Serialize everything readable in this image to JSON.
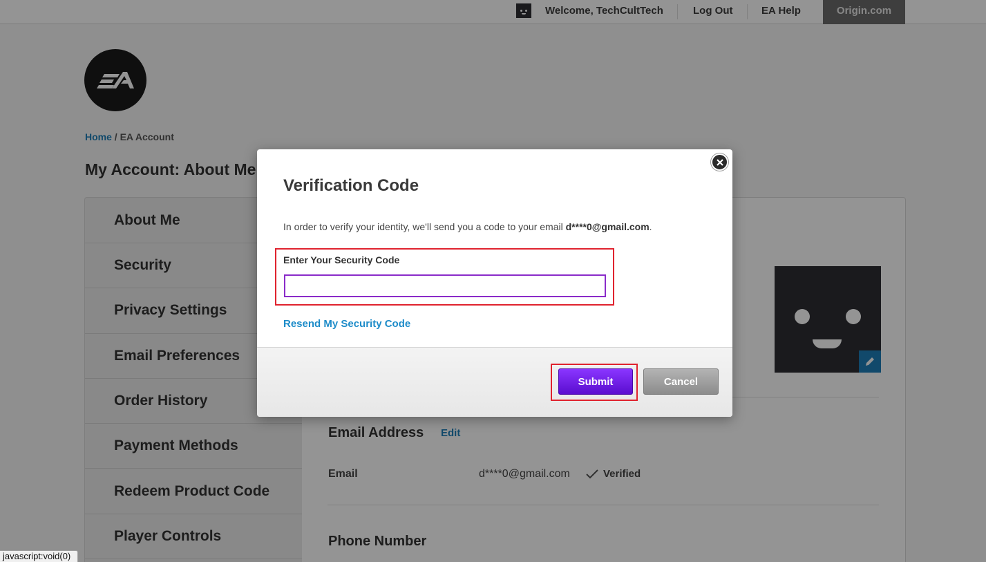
{
  "topbar": {
    "welcome": "Welcome, TechCultTech",
    "logout": "Log Out",
    "help": "EA Help",
    "origin": "Origin.com"
  },
  "logo": {
    "text": "EA"
  },
  "breadcrumb": {
    "home": "Home",
    "separator": " / ",
    "current": "EA Account"
  },
  "page_title": "My Account: About Me",
  "sidebar": {
    "items": [
      {
        "label": "About Me"
      },
      {
        "label": "Security"
      },
      {
        "label": "Privacy Settings"
      },
      {
        "label": "Email Preferences"
      },
      {
        "label": "Order History"
      },
      {
        "label": "Payment Methods"
      },
      {
        "label": "Redeem Product Code"
      },
      {
        "label": "Player Controls"
      }
    ]
  },
  "main": {
    "email_section": {
      "title": "Email Address",
      "edit": "Edit",
      "label": "Email",
      "value": "d****0@gmail.com",
      "status": "Verified"
    },
    "phone_section": {
      "title": "Phone Number"
    }
  },
  "modal": {
    "title": "Verification Code",
    "intro_prefix": "In order to verify your identity, we'll send you a code to your email ",
    "intro_email": "d****0@gmail.com",
    "intro_suffix": ".",
    "code_label": "Enter Your Security Code",
    "code_value": "",
    "resend": "Resend My Security Code",
    "submit": "Submit",
    "cancel": "Cancel"
  },
  "status_bar": "javascript:void(0)",
  "colors": {
    "accent_link": "#1e7fb8",
    "submit_purple": "#6a1ee0",
    "highlight_red": "#e0222e"
  }
}
